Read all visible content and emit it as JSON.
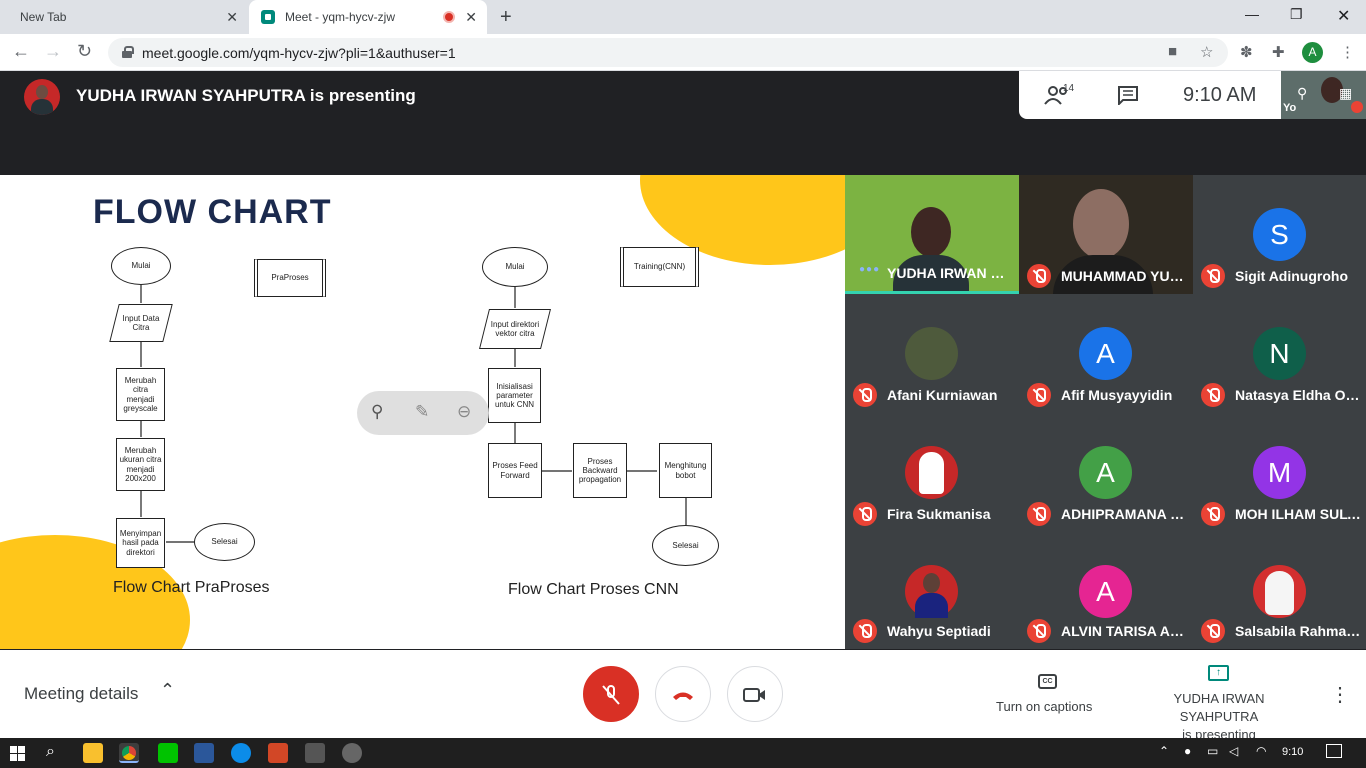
{
  "browser": {
    "tabs": [
      {
        "title": "New Tab",
        "active": false
      },
      {
        "title": "Meet - yqm-hycv-zjw",
        "active": true
      }
    ],
    "url": "meet.google.com/yqm-hycv-zjw?pli=1&authuser=1",
    "profile_initial": "A"
  },
  "meet": {
    "presenting_banner": "YUDHA IRWAN SYAHPUTRA is presenting",
    "people_count": "14",
    "clock": "9:10  AM",
    "self_label": "Yo",
    "slide": {
      "title": "FLOW CHART",
      "left_chart": {
        "caption": "Flow Chart PraProses",
        "process_label": "PraProses",
        "nodes": [
          "Mulai",
          "Input Data Citra",
          "Merubah citra menjadi greyscale",
          "Merubah ukuran citra menjadi 200x200",
          "Menyimpan hasil pada direktori",
          "Selesai"
        ]
      },
      "right_chart": {
        "caption": "Flow Chart Proses CNN",
        "process_label": "Training(CNN)",
        "nodes": [
          "Mulai",
          "Input direktori vektor citra",
          "Inisialisasi parameter untuk CNN",
          "Proses Feed Forward",
          "Proses Backward propagation",
          "Menghitung bobot",
          "Selesai"
        ]
      }
    },
    "participants": [
      {
        "name": "YUDHA IRWAN SY...",
        "type": "video",
        "speaking": true
      },
      {
        "name": "MUHAMMAD YUD...",
        "type": "video"
      },
      {
        "name": "Sigit Adinugroho",
        "initial": "S",
        "color": "#1a73e8"
      },
      {
        "name": "Afani Kurniawan",
        "type": "photo"
      },
      {
        "name": "Afif Musyayyidin",
        "initial": "A",
        "color": "#1a73e8"
      },
      {
        "name": "Natasya Eldha Ok...",
        "initial": "N",
        "color": "#0f5f4a"
      },
      {
        "name": "Fira Sukmanisa",
        "type": "photo"
      },
      {
        "name": "ADHIPRAMANA R...",
        "initial": "A",
        "color": "#43a047"
      },
      {
        "name": "MOH ILHAM SULT...",
        "initial": "M",
        "color": "#9334e6"
      },
      {
        "name": "Wahyu Septiadi",
        "type": "photo"
      },
      {
        "name": "ALVIN TARISA AK...",
        "initial": "A",
        "color": "#e52592"
      },
      {
        "name": "Salsabila Rahma ...",
        "type": "photo"
      }
    ],
    "bottom": {
      "meeting_details": "Meeting details",
      "captions": "Turn on captions",
      "present_line1": "YUDHA IRWAN SYAHPUTRA",
      "present_line2": "is presenting",
      "cc_glyph": "CC"
    }
  },
  "taskbar": {
    "time": "9:10"
  },
  "colors": {
    "accent_red": "#d93025",
    "meet_teal": "#00897b",
    "slide_yellow": "#ffc61a"
  }
}
